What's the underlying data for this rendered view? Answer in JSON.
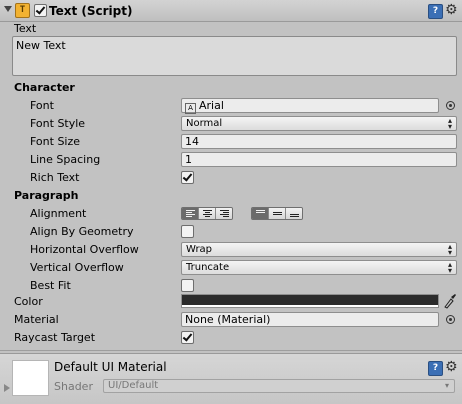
{
  "component": {
    "title": "Text (Script)",
    "icon": "script-icon",
    "enabled": true
  },
  "text_section": {
    "label": "Text",
    "value": "New Text"
  },
  "character": {
    "header": "Character",
    "font_label": "Font",
    "font_value": "Arial",
    "font_style_label": "Font Style",
    "font_style_value": "Normal",
    "font_size_label": "Font Size",
    "font_size_value": "14",
    "line_spacing_label": "Line Spacing",
    "line_spacing_value": "1",
    "rich_text_label": "Rich Text",
    "rich_text_checked": true
  },
  "paragraph": {
    "header": "Paragraph",
    "alignment_label": "Alignment",
    "alignment_horizontal": [
      "left",
      "center",
      "right"
    ],
    "alignment_horizontal_selected": "left",
    "alignment_vertical": [
      "top",
      "middle",
      "bottom"
    ],
    "alignment_vertical_selected": "top",
    "align_by_geometry_label": "Align By Geometry",
    "align_by_geometry_checked": false,
    "horizontal_overflow_label": "Horizontal Overflow",
    "horizontal_overflow_value": "Wrap",
    "vertical_overflow_label": "Vertical Overflow",
    "vertical_overflow_value": "Truncate",
    "best_fit_label": "Best Fit",
    "best_fit_checked": false
  },
  "color_label": "Color",
  "color_value": "#2b2b2b",
  "material_label": "Material",
  "material_value": "None (Material)",
  "raycast_label": "Raycast Target",
  "raycast_checked": true,
  "material_panel": {
    "title": "Default UI Material",
    "shader_label": "Shader",
    "shader_value": "UI/Default"
  }
}
